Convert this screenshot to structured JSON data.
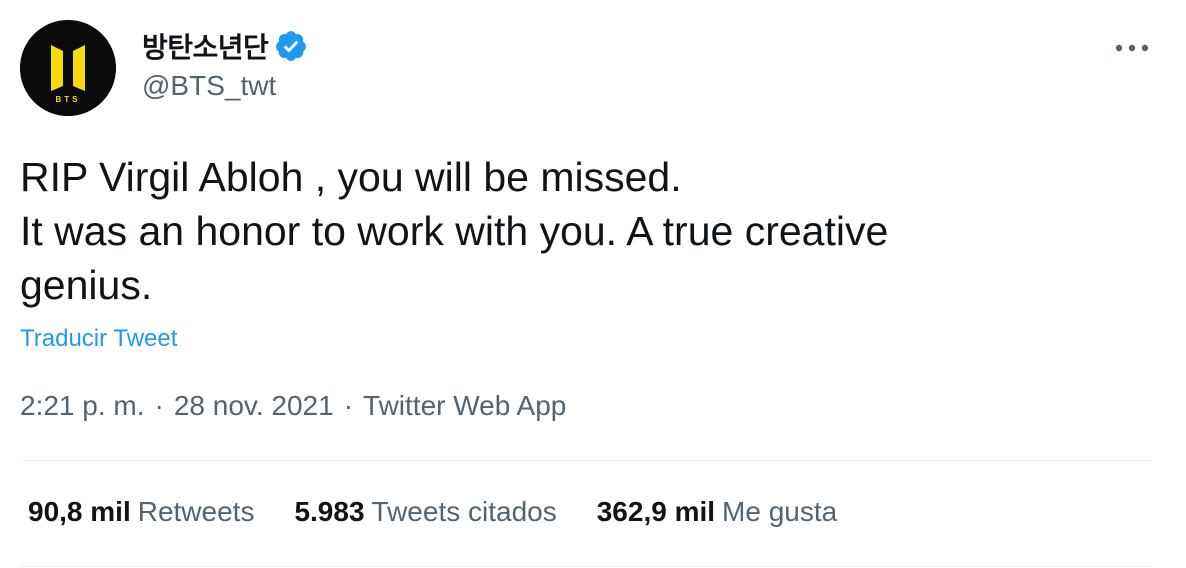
{
  "author": {
    "display_name": "방탄소년단",
    "handle": "@BTS_twt",
    "avatar_text": "BTS",
    "verified_icon": "verified-badge-icon"
  },
  "tweet": {
    "text": "RIP Virgil Abloh , you will be missed.\nIt was an honor to work with you. A true creative\ngenius.",
    "translate_label": "Traducir Tweet",
    "time": "2:21 p. m.",
    "date": "28 nov. 2021",
    "separator": "·",
    "source": "Twitter Web App"
  },
  "stats": [
    {
      "value": "90,8 mil",
      "label": "Retweets"
    },
    {
      "value": "5.983",
      "label": "Tweets citados"
    },
    {
      "value": "362,9 mil",
      "label": "Me gusta"
    }
  ],
  "colors": {
    "text_primary": "#0f1419",
    "text_secondary": "#536471",
    "link": "#1d9bf0",
    "verified": "#1d9bf0",
    "avatar_bg": "#0b0b0b",
    "logo_yellow": "#f5d90a",
    "divider": "#eff3f4"
  }
}
